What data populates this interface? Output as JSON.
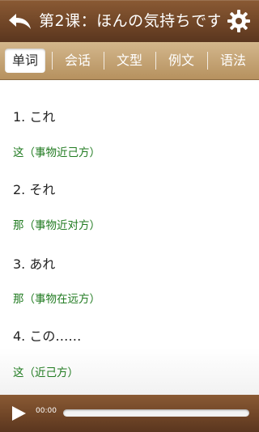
{
  "header": {
    "title": "第2课：ほんの気持ちです",
    "back_icon": "back-arrow-icon",
    "settings_icon": "gear-icon"
  },
  "tabs": [
    {
      "label": "单词",
      "active": true
    },
    {
      "label": "会话",
      "active": false
    },
    {
      "label": "文型",
      "active": false
    },
    {
      "label": "例文",
      "active": false
    },
    {
      "label": "语法",
      "active": false
    }
  ],
  "content": {
    "items": [
      {
        "jp": "1. これ",
        "cn": "这（事物近己方）"
      },
      {
        "jp": "2. それ",
        "cn": "那（事物近对方）"
      },
      {
        "jp": "3. あれ",
        "cn": "那（事物在远方）"
      },
      {
        "jp": "4. この……",
        "cn": "这（近己方）"
      }
    ]
  },
  "player": {
    "time": "00:00",
    "progress": 0,
    "play_icon": "play-icon"
  }
}
